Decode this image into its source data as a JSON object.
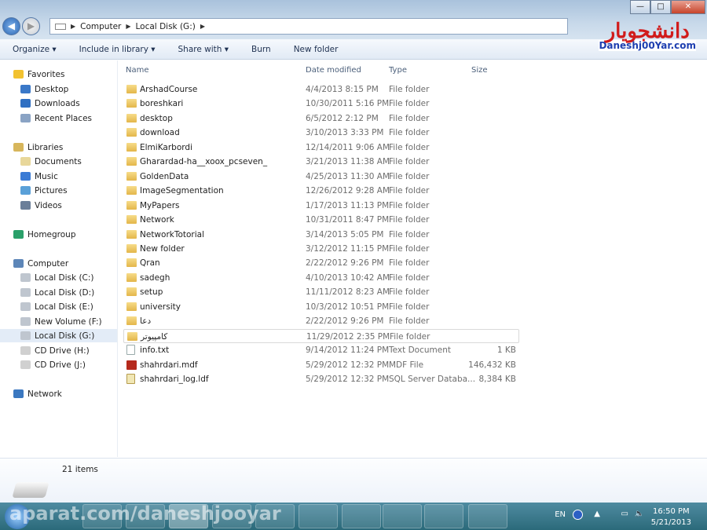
{
  "window": {
    "minimize": "—",
    "maximize": "□",
    "close": "✕"
  },
  "address": {
    "crumbs": [
      "Computer",
      "Local Disk (G:)"
    ]
  },
  "toolbar": {
    "organize": "Organize ▾",
    "include": "Include in library ▾",
    "share": "Share with ▾",
    "burn": "Burn",
    "new_folder": "New folder"
  },
  "logo": {
    "fa": "دانشجویار",
    "en": "Daneshj00Yar.com"
  },
  "sidebar": [
    {
      "label": "Favorites",
      "group": true,
      "color": "#f2c230"
    },
    {
      "label": "Desktop",
      "color": "#3a78c8"
    },
    {
      "label": "Downloads",
      "color": "#2f6fc2"
    },
    {
      "label": "Recent Places",
      "color": "#8aa3c4"
    },
    {
      "label": "Libraries",
      "group": true,
      "color": "#d7b65c"
    },
    {
      "label": "Documents",
      "color": "#e8d79a"
    },
    {
      "label": "Music",
      "color": "#3a7bd5"
    },
    {
      "label": "Pictures",
      "color": "#5aa0d8"
    },
    {
      "label": "Videos",
      "color": "#6b7f99"
    },
    {
      "label": "Homegroup",
      "group": true,
      "color": "#2aa06a"
    },
    {
      "label": "Computer",
      "group": true,
      "color": "#5d86b8"
    },
    {
      "label": "Local Disk (C:)",
      "color": "#bfc6cf"
    },
    {
      "label": "Local Disk (D:)",
      "color": "#bfc6cf"
    },
    {
      "label": "Local Disk (E:)",
      "color": "#bfc6cf"
    },
    {
      "label": "New Volume (F:)",
      "color": "#bfc6cf"
    },
    {
      "label": "Local Disk (G:)",
      "color": "#bfc6cf",
      "selected": true
    },
    {
      "label": "CD Drive (H:)",
      "color": "#d0d0d0"
    },
    {
      "label": "CD Drive (J:)",
      "color": "#d0d0d0"
    },
    {
      "label": "Network",
      "group": true,
      "color": "#3b78c0"
    }
  ],
  "columns": {
    "name": "Name",
    "date": "Date modified",
    "type": "Type",
    "size": "Size"
  },
  "files": [
    {
      "name": "ArshadCourse",
      "date": "4/4/2013 8:15 PM",
      "type": "File folder",
      "size": "",
      "icon": "folder"
    },
    {
      "name": "boreshkari",
      "date": "10/30/2011 5:16 PM",
      "type": "File folder",
      "size": "",
      "icon": "folder"
    },
    {
      "name": "desktop",
      "date": "6/5/2012 2:12 PM",
      "type": "File folder",
      "size": "",
      "icon": "folder"
    },
    {
      "name": "download",
      "date": "3/10/2013 3:33 PM",
      "type": "File folder",
      "size": "",
      "icon": "folder"
    },
    {
      "name": "ElmiKarbordi",
      "date": "12/14/2011 9:06 AM",
      "type": "File folder",
      "size": "",
      "icon": "folder"
    },
    {
      "name": "Gharardad-ha__xoox_pcseven_",
      "date": "3/21/2013 11:38 AM",
      "type": "File folder",
      "size": "",
      "icon": "folder"
    },
    {
      "name": "GoldenData",
      "date": "4/25/2013 11:30 AM",
      "type": "File folder",
      "size": "",
      "icon": "folder"
    },
    {
      "name": "ImageSegmentation",
      "date": "12/26/2012 9:28 AM",
      "type": "File folder",
      "size": "",
      "icon": "folder"
    },
    {
      "name": "MyPapers",
      "date": "1/17/2013 11:13 PM",
      "type": "File folder",
      "size": "",
      "icon": "folder"
    },
    {
      "name": "Network",
      "date": "10/31/2011 8:47 PM",
      "type": "File folder",
      "size": "",
      "icon": "folder"
    },
    {
      "name": "NetworkTotorial",
      "date": "3/14/2013 5:05 PM",
      "type": "File folder",
      "size": "",
      "icon": "folder"
    },
    {
      "name": "New folder",
      "date": "3/12/2012 11:15 PM",
      "type": "File folder",
      "size": "",
      "icon": "folder"
    },
    {
      "name": "Qran",
      "date": "2/22/2012 9:26 PM",
      "type": "File folder",
      "size": "",
      "icon": "folder"
    },
    {
      "name": "sadegh",
      "date": "4/10/2013 10:42 AM",
      "type": "File folder",
      "size": "",
      "icon": "folder"
    },
    {
      "name": "setup",
      "date": "11/11/2012 8:23 AM",
      "type": "File folder",
      "size": "",
      "icon": "folder"
    },
    {
      "name": "university",
      "date": "10/3/2012 10:51 PM",
      "type": "File folder",
      "size": "",
      "icon": "folder"
    },
    {
      "name": "دعا",
      "date": "2/22/2012 9:26 PM",
      "type": "File folder",
      "size": "",
      "icon": "folder"
    },
    {
      "name": "کامپیوتر",
      "date": "11/29/2012 2:35 PM",
      "type": "File folder",
      "size": "",
      "icon": "folder",
      "hover": true
    },
    {
      "name": "info.txt",
      "date": "9/14/2012 11:24 PM",
      "type": "Text Document",
      "size": "1 KB",
      "icon": "txt"
    },
    {
      "name": "shahrdari.mdf",
      "date": "5/29/2012 12:32 PM",
      "type": "MDF File",
      "size": "146,432 KB",
      "icon": "mdf"
    },
    {
      "name": "shahrdari_log.ldf",
      "date": "5/29/2012 12:32 PM",
      "type": "SQL Server Databa...",
      "size": "8,384 KB",
      "icon": "ldf"
    }
  ],
  "status": {
    "count": "21 items"
  },
  "taskbar": {
    "watermark": "aparat.com/daneshjooyar",
    "lang": "EN",
    "time": "16:50 PM",
    "date": "5/21/2013"
  }
}
